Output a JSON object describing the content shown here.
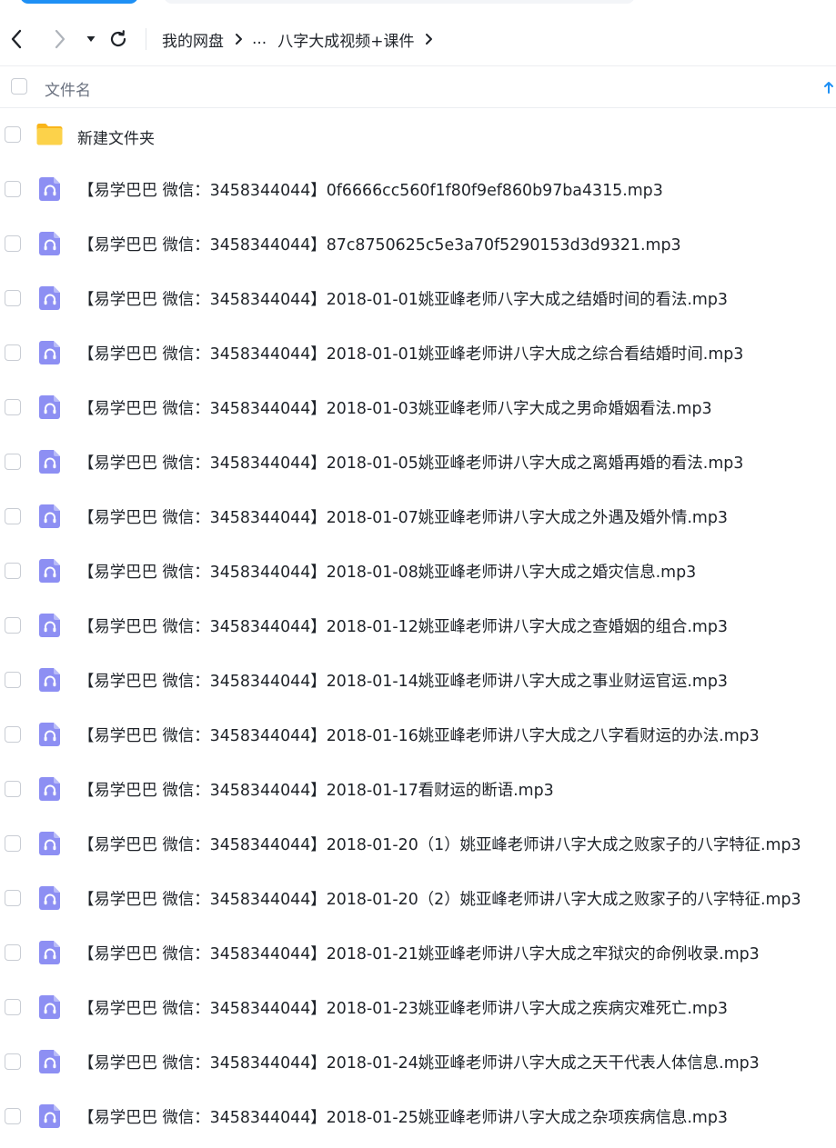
{
  "toolbar": {
    "back_icon": "chevron-left-icon",
    "forward_icon": "chevron-right-icon",
    "dropdown_icon": "caret-down-icon",
    "refresh_icon": "refresh-icon"
  },
  "breadcrumb": {
    "root": "我的网盘",
    "ellipsis": "...",
    "current": "八字大成视频+课件"
  },
  "list_header": {
    "name_label": "文件名",
    "sort_icon": "sort-ascending-icon"
  },
  "colors": {
    "accent": "#1e90f5",
    "folder": "#fbc531",
    "audio_icon": "#8b8ff2",
    "text": "#1f2329",
    "muted": "#6b7280"
  },
  "files": [
    {
      "type": "folder",
      "name": "新建文件夹"
    },
    {
      "type": "audio",
      "name": "【易学巴巴 微信：3458344044】0f6666cc560f1f80f9ef860b97ba4315.mp3"
    },
    {
      "type": "audio",
      "name": "【易学巴巴 微信：3458344044】87c8750625c5e3a70f5290153d3d9321.mp3"
    },
    {
      "type": "audio",
      "name": "【易学巴巴 微信：3458344044】2018-01-01姚亚峰老师八字大成之结婚时间的看法.mp3"
    },
    {
      "type": "audio",
      "name": "【易学巴巴 微信：3458344044】2018-01-01姚亚峰老师讲八字大成之综合看结婚时间.mp3"
    },
    {
      "type": "audio",
      "name": "【易学巴巴 微信：3458344044】2018-01-03姚亚峰老师八字大成之男命婚姻看法.mp3"
    },
    {
      "type": "audio",
      "name": "【易学巴巴 微信：3458344044】2018-01-05姚亚峰老师讲八字大成之离婚再婚的看法.mp3"
    },
    {
      "type": "audio",
      "name": "【易学巴巴 微信：3458344044】2018-01-07姚亚峰老师讲八字大成之外遇及婚外情.mp3"
    },
    {
      "type": "audio",
      "name": "【易学巴巴 微信：3458344044】2018-01-08姚亚峰老师讲八字大成之婚灾信息.mp3"
    },
    {
      "type": "audio",
      "name": "【易学巴巴 微信：3458344044】2018-01-12姚亚峰老师讲八字大成之查婚姻的组合.mp3"
    },
    {
      "type": "audio",
      "name": "【易学巴巴 微信：3458344044】2018-01-14姚亚峰老师讲八字大成之事业财运官运.mp3"
    },
    {
      "type": "audio",
      "name": "【易学巴巴 微信：3458344044】2018-01-16姚亚峰老师讲八字大成之八字看财运的办法.mp3"
    },
    {
      "type": "audio",
      "name": "【易学巴巴 微信：3458344044】2018-01-17看财运的断语.mp3"
    },
    {
      "type": "audio",
      "name": "【易学巴巴 微信：3458344044】2018-01-20（1）姚亚峰老师讲八字大成之败家子的八字特征.mp3"
    },
    {
      "type": "audio",
      "name": "【易学巴巴 微信：3458344044】2018-01-20（2）姚亚峰老师讲八字大成之败家子的八字特征.mp3"
    },
    {
      "type": "audio",
      "name": "【易学巴巴 微信：3458344044】2018-01-21姚亚峰老师讲八字大成之牢狱灾的命例收录.mp3"
    },
    {
      "type": "audio",
      "name": "【易学巴巴 微信：3458344044】2018-01-23姚亚峰老师讲八字大成之疾病灾难死亡.mp3"
    },
    {
      "type": "audio",
      "name": "【易学巴巴 微信：3458344044】2018-01-24姚亚峰老师讲八字大成之天干代表人体信息.mp3"
    },
    {
      "type": "audio",
      "name": "【易学巴巴 微信：3458344044】2018-01-25姚亚峰老师讲八字大成之杂项疾病信息.mp3"
    }
  ]
}
